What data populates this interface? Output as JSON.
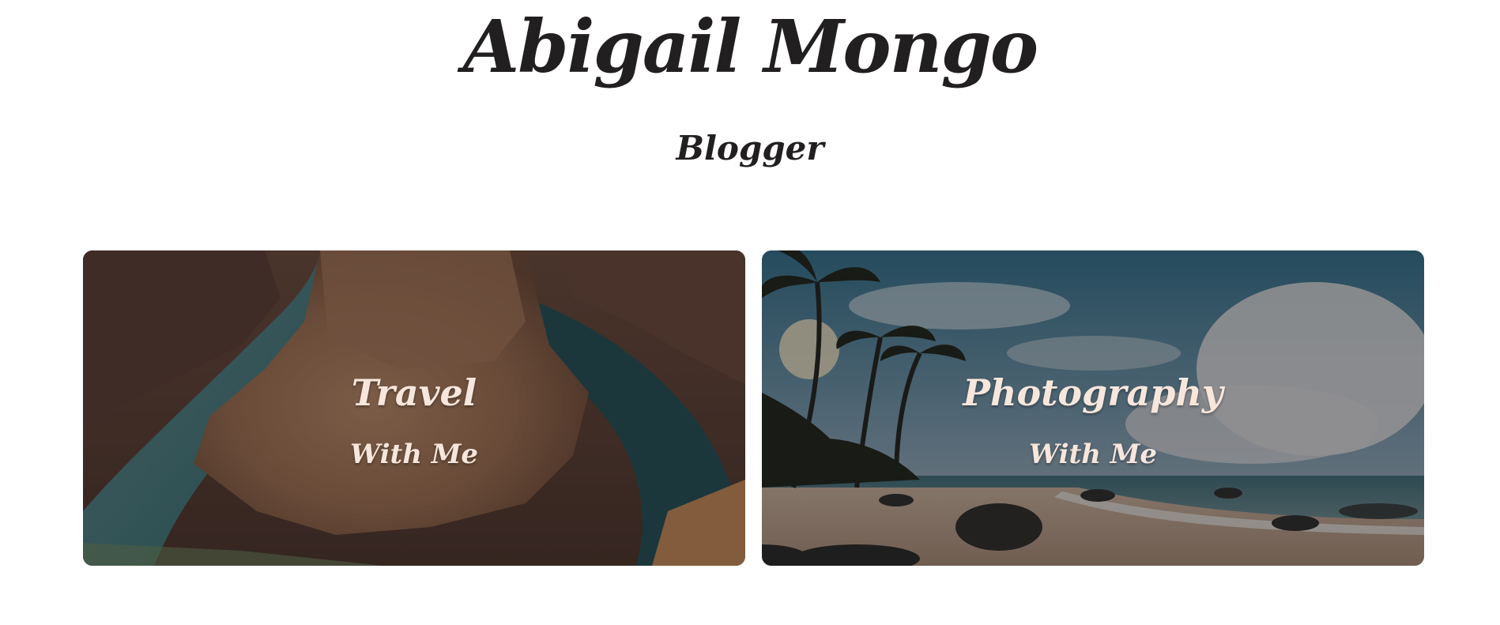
{
  "header": {
    "title": "Abigail Mongo",
    "subtitle": "Blogger"
  },
  "cards": [
    {
      "title": "Travel",
      "subtitle": "With Me",
      "image": "canyon-river-bend-photo"
    },
    {
      "title": "Photography",
      "subtitle": "With Me",
      "image": "tropical-beach-palm-photo"
    }
  ],
  "colors": {
    "heading": "#221f20",
    "card_text": "#f6e6dc",
    "background": "#ffffff"
  }
}
